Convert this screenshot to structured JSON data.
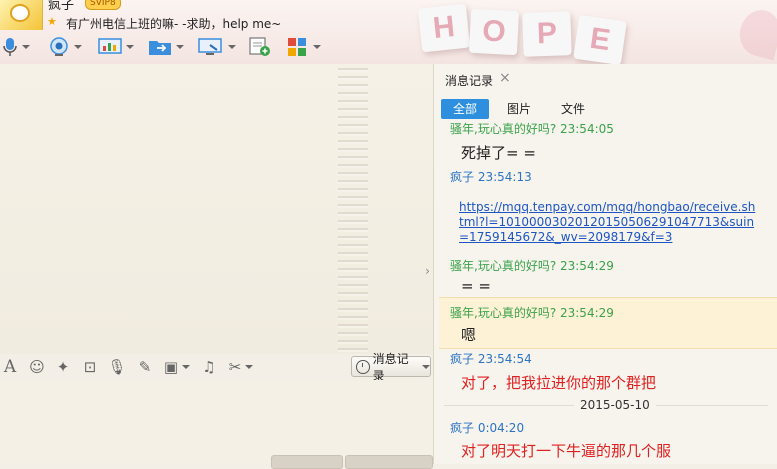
{
  "window": {
    "contact_name": "疯子",
    "vip_label": "SVIP8",
    "signature": "有广州电信上班的嘛- -求助，help me~",
    "banner_letters": [
      "H",
      "O",
      "P",
      "E"
    ]
  },
  "toolbar": {
    "icons": [
      "microphone-icon",
      "video-camera-icon",
      "share-screen-icon",
      "send-file-icon",
      "remote-desktop-icon",
      "create-group-icon",
      "apps-icon"
    ]
  },
  "input_toolbar": {
    "icons": [
      "font-icon",
      "emoji-icon",
      "magic-icon",
      "screenshot-icon",
      "voice-icon",
      "edit-icon",
      "image-icon",
      "music-icon",
      "scissors-icon"
    ],
    "history_button_label": "消息记录"
  },
  "history_panel": {
    "title": "消息记录",
    "tabs": [
      {
        "label": "全部",
        "active": true
      },
      {
        "label": "图片",
        "active": false
      },
      {
        "label": "文件",
        "active": false
      }
    ],
    "messages": [
      {
        "sender": "骚年,玩心真的好吗? 23:54:05",
        "sender_color": "green",
        "content": "死掉了= ="
      },
      {
        "sender": "疯子 23:54:13",
        "sender_color": "blue",
        "link": "https://mqq.tenpay.com/mqq/hongbao/receive.shtml?l=10100003020120150506291047713&suin=1759145672&_wv=2098179&f=3"
      },
      {
        "sender": "骚年,玩心真的好吗? 23:54:29",
        "sender_color": "green",
        "content": "= ="
      },
      {
        "sender": "骚年,玩心真的好吗? 23:54:29",
        "sender_color": "green",
        "content": "嗯",
        "highlighted": true
      },
      {
        "sender": "疯子 23:54:54",
        "sender_color": "blue",
        "content": "对了，把我拉进你的那个群把",
        "content_color": "red"
      },
      {
        "date_separator": "2015-05-10"
      },
      {
        "sender": "疯子 0:04:20",
        "sender_color": "blue",
        "content": "对了明天打一下牛逼的那几个服",
        "content_color": "red"
      }
    ]
  }
}
